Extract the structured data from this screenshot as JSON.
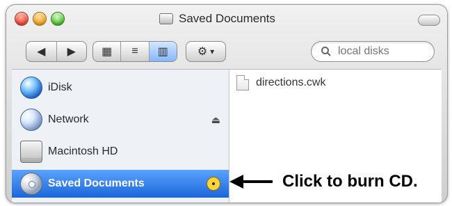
{
  "window": {
    "title": "Saved Documents"
  },
  "toolbar": {
    "nav": {
      "back_glyph": "◀",
      "forward_glyph": "▶"
    },
    "views": {
      "icon_glyph": "▦",
      "list_glyph": "≡",
      "column_glyph": "▥"
    },
    "action": {
      "glyph": "⚙",
      "chevron": "▾"
    },
    "search": {
      "placeholder": "local disks"
    }
  },
  "sidebar": {
    "items": [
      {
        "label": "iDisk",
        "icon": "idisk-icon"
      },
      {
        "label": "Network",
        "icon": "network-icon",
        "right_icon": "eject-icon",
        "right_glyph": "⏏"
      },
      {
        "label": "Macintosh HD",
        "icon": "hard-disk-icon"
      },
      {
        "label": "Saved Documents",
        "icon": "cd-icon",
        "selected": true,
        "right_icon": "burn-icon"
      }
    ]
  },
  "files": [
    {
      "name": "directions.cwk",
      "icon": "document-icon"
    }
  ],
  "callout": {
    "text": "Click to burn CD."
  }
}
